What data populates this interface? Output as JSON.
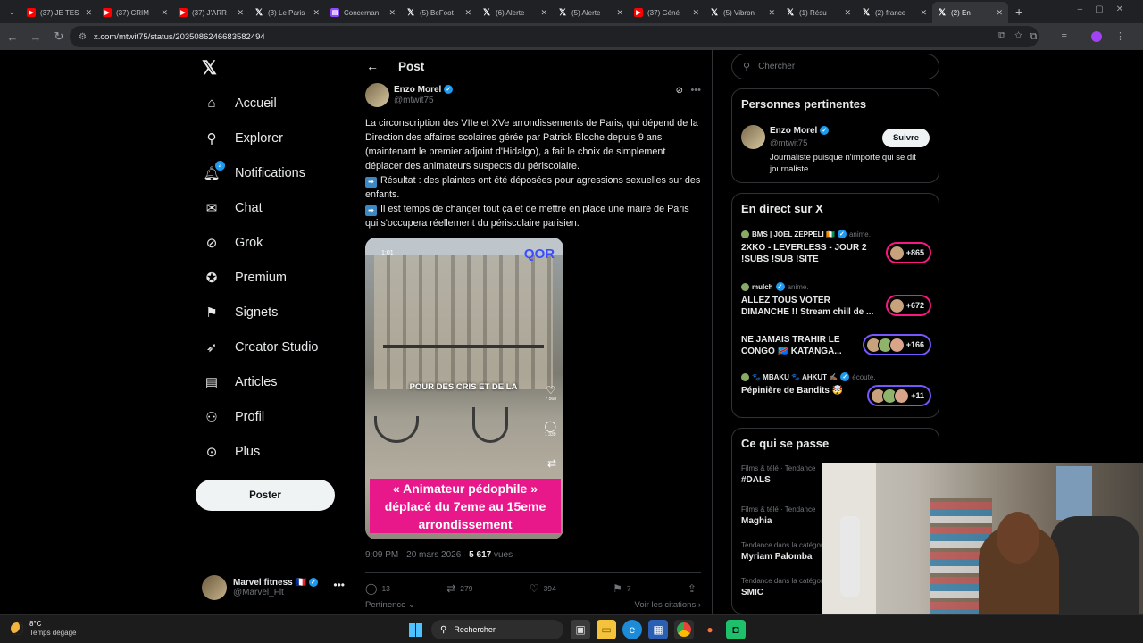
{
  "browser": {
    "tabs": [
      {
        "icon": "youtube-icon",
        "title": "(37) JE TES"
      },
      {
        "icon": "youtube-icon",
        "title": "(37) CRIM"
      },
      {
        "icon": "youtube-icon",
        "title": "(37) J'ARR"
      },
      {
        "icon": "x-icon",
        "title": "(3) Le Paris"
      },
      {
        "icon": "twitch-icon",
        "title": "Concernan"
      },
      {
        "icon": "x-icon",
        "title": "(5) BeFoot"
      },
      {
        "icon": "x-icon",
        "title": "(6) Alerte"
      },
      {
        "icon": "x-icon",
        "title": "(5) Alerte"
      },
      {
        "icon": "youtube-icon",
        "title": "(37) Géné"
      },
      {
        "icon": "x-icon",
        "title": "(5) Vibron"
      },
      {
        "icon": "x-icon",
        "title": "(1) Résu"
      },
      {
        "icon": "x-icon",
        "title": "(2) france"
      },
      {
        "icon": "x-icon",
        "title": "(2) En"
      }
    ],
    "url": "x.com/mtwit75/status/2035086246683582494"
  },
  "nav": {
    "items": [
      {
        "icon": "home-icon",
        "label": "Accueil"
      },
      {
        "icon": "search-icon",
        "label": "Explorer"
      },
      {
        "icon": "bell-icon",
        "label": "Notifications",
        "badge": "2"
      },
      {
        "icon": "mail-icon",
        "label": "Chat"
      },
      {
        "icon": "grok-icon",
        "label": "Grok"
      },
      {
        "icon": "verified-icon",
        "label": "Premium"
      },
      {
        "icon": "bookmark-icon",
        "label": "Signets"
      },
      {
        "icon": "rocket-icon",
        "label": "Creator Studio"
      },
      {
        "icon": "article-icon",
        "label": "Articles"
      },
      {
        "icon": "person-icon",
        "label": "Profil"
      },
      {
        "icon": "more-circle-icon",
        "label": "Plus"
      }
    ],
    "post_button": "Poster",
    "account": {
      "name": "Marvel fitness 🇫🇷",
      "handle": "@Marvel_Flt"
    }
  },
  "post": {
    "header": "Post",
    "author_name": "Enzo Morel",
    "author_handle": "@mtwit75",
    "text": [
      "La circonscription des VIIe et XVe arrondissements de Paris, qui dépend de la Direction des affaires scolaires gérée par Patrick Bloche depuis 9 ans (maintenant le premier adjoint d'Hidalgo), a fait le choix de simplement déplacer des animateurs suspects du périscolaire.",
      "Résultat : des plaintes ont été déposées pour agressions sexuelles sur des enfants.",
      "Il est temps de changer tout ça et de mettre en place une maire de Paris qui s'occupera réellement du périscolaire parisien."
    ],
    "video": {
      "time": "1:01",
      "logo": "QOR",
      "subtitle": "POUR DES CRIS ET DE LA",
      "like_count": "7 568",
      "comment_count": "1 339",
      "banner": "« Animateur pédophile » déplacé du 7eme au 15eme arrondissement"
    },
    "timestamp": "9:09 PM · 20 mars 2026 · ",
    "views_count": "5 617",
    "views_label": " vues",
    "stats": {
      "replies": "13",
      "reposts": "279",
      "likes": "394",
      "bookmarks": "7"
    },
    "relevance": "Pertinence",
    "quotes_link": "Voir les citations ›"
  },
  "right": {
    "search_placeholder": "Chercher",
    "relevant": {
      "title": "Personnes pertinentes",
      "name": "Enzo Morel",
      "handle": "@mtwit75",
      "bio": "Journaliste puisque n'importe qui se dit journaliste",
      "follow": "Suivre"
    },
    "live": {
      "title": "En direct sur X",
      "items": [
        {
          "host": "BMS | JOEL ZEPPELI 🇨🇮",
          "action": "anime.",
          "title": "2XKO - LEVERLESS - JOUR 2 !SUBS !SUB !SITE",
          "count": "+865",
          "color": "#f91880"
        },
        {
          "host": "mulch",
          "action": "anime.",
          "title": "ALLEZ TOUS VOTER DIMANCHE !! Stream chill de ...",
          "count": "+672",
          "color": "#f91880"
        },
        {
          "host": "",
          "action": "",
          "title": "NE JAMAIS TRAHIR LE CONGO 🇨🇩 KATANGA...",
          "count": "+166",
          "color": "#7856ff"
        },
        {
          "host": "🐾 MBAKU 🐾 AHKUT ✍🏾",
          "action": "écoute.",
          "title": "Pépinière de Bandits 🤯",
          "count": "+11",
          "color": "#7856ff"
        }
      ]
    },
    "trends": {
      "title": "Ce qui se passe",
      "items": [
        {
          "category": "Films & télé · Tendance",
          "name": "#DALS"
        },
        {
          "category": "Films & télé · Tendance",
          "name": "Maghia"
        },
        {
          "category": "Tendance dans la catégorie",
          "name": "Myriam Palomba"
        },
        {
          "category": "Tendance dans la catégorie",
          "name": "SMIC"
        }
      ]
    }
  },
  "taskbar": {
    "temp": "8°C",
    "weather": "Temps dégagé",
    "search": "Rechercher"
  }
}
